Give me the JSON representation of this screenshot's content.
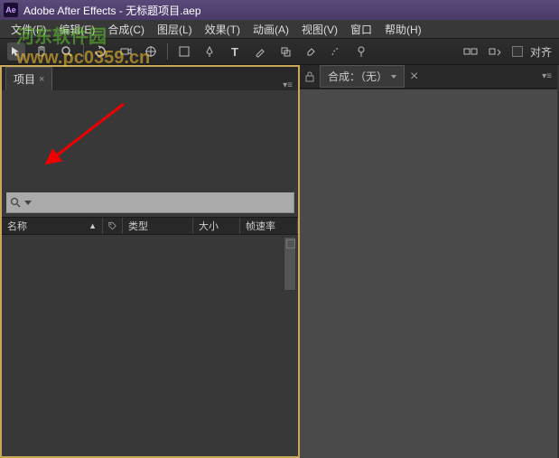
{
  "titlebar": {
    "app_icon_text": "Ae",
    "title": "Adobe After Effects - 无标题项目.aep"
  },
  "menubar": {
    "items": [
      "文件(F)",
      "编辑(E)",
      "合成(C)",
      "图层(L)",
      "效果(T)",
      "动画(A)",
      "视图(V)",
      "窗口",
      "帮助(H)"
    ]
  },
  "watermark": {
    "text1": "河东软件园",
    "text2": "www.pc0359.cn"
  },
  "toolbar": {
    "align_label": "对齐"
  },
  "left_panel": {
    "tab_label": "项目",
    "search_placeholder": "",
    "columns": {
      "name": "名称",
      "type": "类型",
      "size": "大小",
      "fps": "帧速率"
    }
  },
  "right_panel": {
    "comp_label": "合成：（无）"
  }
}
